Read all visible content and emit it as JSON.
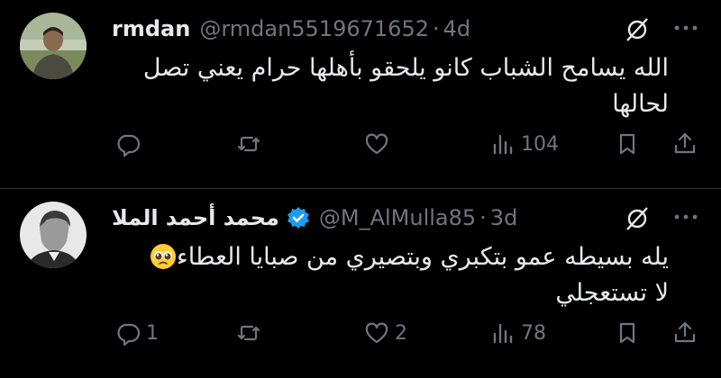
{
  "tweets": [
    {
      "name": "rmdan",
      "handle": "@rmdan5519671652",
      "time": "4d",
      "text_line1": "الله يسامح الشباب كانو يلحقو بأهلها حرام يعني تصل",
      "text_line2": "لحالها",
      "verified": false,
      "stats": {
        "replies": "",
        "reposts": "",
        "likes": "",
        "views": "104"
      }
    },
    {
      "name": "محمد أحمد الملا",
      "handle": "@M_AlMulla85",
      "time": "3d",
      "text_line1": "يله بسيطه عمو بتكبري وبتصيري من صبايا العطاء",
      "text_line2": "لا تستعجلي",
      "verified": true,
      "stats": {
        "replies": "1",
        "reposts": "",
        "likes": "2",
        "views": "78"
      }
    }
  ],
  "icons": {
    "reply": "reply-icon",
    "repost": "repost-icon",
    "like": "like-icon",
    "views": "views-icon",
    "bookmark": "bookmark-icon",
    "share": "share-icon",
    "grok": "grok-icon",
    "more": "more-icon"
  },
  "colors": {
    "background": "#000000",
    "text": "#e7e9ea",
    "muted": "#71767b",
    "verified": "#1d9bf0",
    "divider": "#2f3336"
  }
}
